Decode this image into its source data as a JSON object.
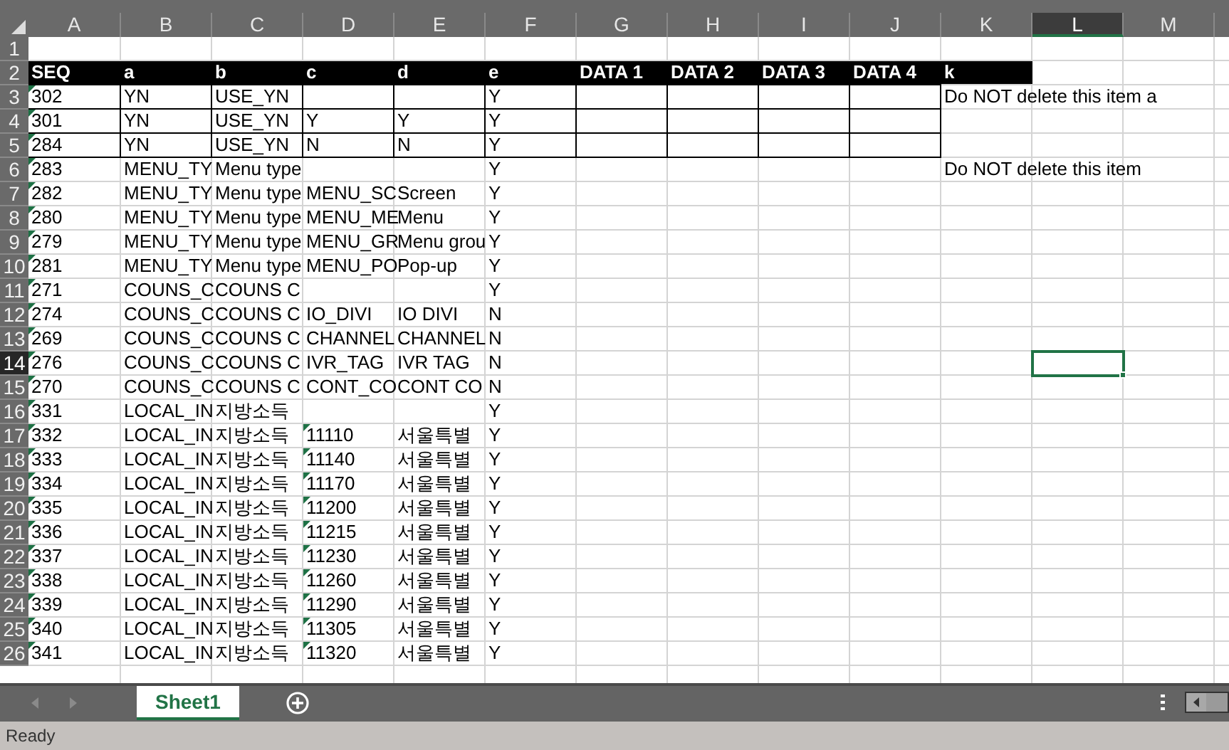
{
  "columns": [
    {
      "label": "A",
      "selected": false
    },
    {
      "label": "B",
      "selected": false
    },
    {
      "label": "C",
      "selected": false
    },
    {
      "label": "D",
      "selected": false
    },
    {
      "label": "E",
      "selected": false
    },
    {
      "label": "F",
      "selected": false
    },
    {
      "label": "G",
      "selected": false
    },
    {
      "label": "H",
      "selected": false
    },
    {
      "label": "I",
      "selected": false
    },
    {
      "label": "J",
      "selected": false
    },
    {
      "label": "K",
      "selected": false
    },
    {
      "label": "L",
      "selected": true
    },
    {
      "label": "M",
      "selected": false
    }
  ],
  "rows": [
    {
      "number": "1",
      "selected": false,
      "kind": "plain",
      "flag_a": false,
      "flag_d": false
    },
    {
      "number": "2",
      "selected": false,
      "kind": "header",
      "flag_a": false,
      "flag_d": false,
      "cells": [
        "SEQ",
        "a",
        "b",
        "c",
        "d",
        "e",
        "DATA 1",
        "DATA 2",
        "DATA 3",
        "DATA 4",
        "k",
        null,
        null
      ]
    },
    {
      "number": "3",
      "selected": false,
      "kind": "boxed",
      "flag_a": true,
      "flag_d": false,
      "cells": [
        "302",
        "YN",
        "USE_YN",
        null,
        null,
        "Y",
        null,
        null,
        null,
        null,
        "Do NOT delete this item a",
        null,
        null
      ]
    },
    {
      "number": "4",
      "selected": false,
      "kind": "boxed",
      "flag_a": true,
      "flag_d": false,
      "cells": [
        "301",
        "YN",
        "USE_YN",
        "Y",
        "Y",
        "Y",
        null,
        null,
        null,
        null,
        null,
        null,
        null
      ]
    },
    {
      "number": "5",
      "selected": false,
      "kind": "boxed",
      "flag_a": true,
      "flag_d": false,
      "cells": [
        "284",
        "YN",
        "USE_YN",
        "N",
        "N",
        "Y",
        null,
        null,
        null,
        null,
        null,
        null,
        null
      ]
    },
    {
      "number": "6",
      "selected": false,
      "kind": "plain",
      "flag_a": true,
      "flag_d": false,
      "cells": [
        "283",
        "MENU_TY",
        "Menu type",
        null,
        null,
        "Y",
        null,
        null,
        null,
        null,
        "Do NOT delete this item",
        null,
        null
      ]
    },
    {
      "number": "7",
      "selected": false,
      "kind": "plain",
      "flag_a": true,
      "flag_d": false,
      "cells": [
        "282",
        "MENU_TY",
        "Menu type",
        "MENU_SC",
        "Screen",
        "Y",
        null,
        null,
        null,
        null,
        null,
        null,
        null
      ]
    },
    {
      "number": "8",
      "selected": false,
      "kind": "plain",
      "flag_a": true,
      "flag_d": false,
      "cells": [
        "280",
        "MENU_TY",
        "Menu type",
        "MENU_ME",
        "Menu",
        "Y",
        null,
        null,
        null,
        null,
        null,
        null,
        null
      ]
    },
    {
      "number": "9",
      "selected": false,
      "kind": "plain",
      "flag_a": true,
      "flag_d": false,
      "cells": [
        "279",
        "MENU_TY",
        "Menu type",
        "MENU_GR",
        "Menu grou",
        "Y",
        null,
        null,
        null,
        null,
        null,
        null,
        null
      ]
    },
    {
      "number": "10",
      "selected": false,
      "kind": "plain",
      "flag_a": true,
      "flag_d": false,
      "cells": [
        "281",
        "MENU_TY",
        "Menu type",
        "MENU_PO",
        "Pop-up",
        "Y",
        null,
        null,
        null,
        null,
        null,
        null,
        null
      ]
    },
    {
      "number": "11",
      "selected": false,
      "kind": "plain",
      "flag_a": true,
      "flag_d": false,
      "cells": [
        "271",
        "COUNS_C",
        "COUNS C",
        null,
        null,
        "Y",
        null,
        null,
        null,
        null,
        null,
        null,
        null
      ]
    },
    {
      "number": "12",
      "selected": false,
      "kind": "plain",
      "flag_a": true,
      "flag_d": false,
      "cells": [
        "274",
        "COUNS_C",
        "COUNS C",
        "IO_DIVI",
        "IO DIVI",
        "N",
        null,
        null,
        null,
        null,
        null,
        null,
        null
      ]
    },
    {
      "number": "13",
      "selected": false,
      "kind": "plain",
      "flag_a": true,
      "flag_d": false,
      "cells": [
        "269",
        "COUNS_C",
        "COUNS C",
        "CHANNEL",
        "CHANNEL",
        "N",
        null,
        null,
        null,
        null,
        null,
        null,
        null
      ]
    },
    {
      "number": "14",
      "selected": true,
      "kind": "plain",
      "flag_a": true,
      "flag_d": false,
      "cells": [
        "276",
        "COUNS_C",
        "COUNS C",
        "IVR_TAG",
        "IVR TAG",
        "N",
        null,
        null,
        null,
        null,
        null,
        null,
        null
      ]
    },
    {
      "number": "15",
      "selected": false,
      "kind": "plain",
      "flag_a": true,
      "flag_d": false,
      "cells": [
        "270",
        "COUNS_C",
        "COUNS C",
        "CONT_CO",
        "CONT CO",
        "N",
        null,
        null,
        null,
        null,
        null,
        null,
        null
      ]
    },
    {
      "number": "16",
      "selected": false,
      "kind": "plain",
      "flag_a": true,
      "flag_d": false,
      "cells": [
        "331",
        "LOCAL_IN",
        "지방소득",
        null,
        null,
        "Y",
        null,
        null,
        null,
        null,
        null,
        null,
        null
      ]
    },
    {
      "number": "17",
      "selected": false,
      "kind": "plain",
      "flag_a": true,
      "flag_d": true,
      "cells": [
        "332",
        "LOCAL_IN",
        "지방소득",
        "11110",
        "서울특별",
        "Y",
        null,
        null,
        null,
        null,
        null,
        null,
        null
      ]
    },
    {
      "number": "18",
      "selected": false,
      "kind": "plain",
      "flag_a": true,
      "flag_d": true,
      "cells": [
        "333",
        "LOCAL_IN",
        "지방소득",
        "11140",
        "서울특별",
        "Y",
        null,
        null,
        null,
        null,
        null,
        null,
        null
      ]
    },
    {
      "number": "19",
      "selected": false,
      "kind": "plain",
      "flag_a": true,
      "flag_d": true,
      "cells": [
        "334",
        "LOCAL_IN",
        "지방소득",
        "11170",
        "서울특별",
        "Y",
        null,
        null,
        null,
        null,
        null,
        null,
        null
      ]
    },
    {
      "number": "20",
      "selected": false,
      "kind": "plain",
      "flag_a": true,
      "flag_d": true,
      "cells": [
        "335",
        "LOCAL_IN",
        "지방소득",
        "11200",
        "서울특별",
        "Y",
        null,
        null,
        null,
        null,
        null,
        null,
        null
      ]
    },
    {
      "number": "21",
      "selected": false,
      "kind": "plain",
      "flag_a": true,
      "flag_d": true,
      "cells": [
        "336",
        "LOCAL_IN",
        "지방소득",
        "11215",
        "서울특별",
        "Y",
        null,
        null,
        null,
        null,
        null,
        null,
        null
      ]
    },
    {
      "number": "22",
      "selected": false,
      "kind": "plain",
      "flag_a": true,
      "flag_d": true,
      "cells": [
        "337",
        "LOCAL_IN",
        "지방소득",
        "11230",
        "서울특별",
        "Y",
        null,
        null,
        null,
        null,
        null,
        null,
        null
      ]
    },
    {
      "number": "23",
      "selected": false,
      "kind": "plain",
      "flag_a": true,
      "flag_d": true,
      "cells": [
        "338",
        "LOCAL_IN",
        "지방소득",
        "11260",
        "서울특별",
        "Y",
        null,
        null,
        null,
        null,
        null,
        null,
        null
      ]
    },
    {
      "number": "24",
      "selected": false,
      "kind": "plain",
      "flag_a": true,
      "flag_d": true,
      "cells": [
        "339",
        "LOCAL_IN",
        "지방소득",
        "11290",
        "서울특별",
        "Y",
        null,
        null,
        null,
        null,
        null,
        null,
        null
      ]
    },
    {
      "number": "25",
      "selected": false,
      "kind": "plain",
      "flag_a": true,
      "flag_d": true,
      "cells": [
        "340",
        "LOCAL_IN",
        "지방소득",
        "11305",
        "서울특별",
        "Y",
        null,
        null,
        null,
        null,
        null,
        null,
        null
      ]
    },
    {
      "number": "26",
      "selected": false,
      "kind": "plain",
      "flag_a": true,
      "flag_d": true,
      "cells": [
        "341",
        "LOCAL_IN",
        "지방소득",
        "11320",
        "서울특별",
        "Y",
        null,
        null,
        null,
        null,
        null,
        null,
        null
      ]
    }
  ],
  "sheet_tabs": [
    {
      "label": "Sheet1",
      "selected": true
    }
  ],
  "status_bar": {
    "text": "Ready"
  }
}
